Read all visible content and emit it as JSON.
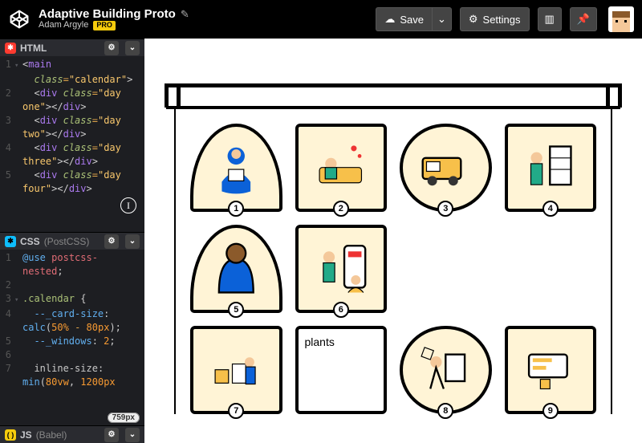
{
  "header": {
    "title": "Adaptive Building Proto",
    "author": "Adam Argyle",
    "author_badge": "PRO",
    "pencil_glyph": "✎",
    "buttons": {
      "save": "Save",
      "save_caret": "⌄",
      "settings": "Settings",
      "cloud_glyph": "☁",
      "gear_glyph": "⚙",
      "layout_glyph": "▥",
      "pin_glyph": "📌"
    }
  },
  "editors": {
    "html": {
      "label": "HTML",
      "gear_glyph": "⚙",
      "caret_glyph": "⌄",
      "cursor_badge": "759px",
      "lines": [
        {
          "n": "1",
          "fold": "▾",
          "html": "<span class='t-punc'>&lt;</span><span class='t-tag'>main</span>"
        },
        {
          "n": "",
          "fold": "",
          "html": "  <span class='t-attr'>class</span><span class='t-op'>=</span><span class='t-str'>\"calendar\"</span><span class='t-punc'>&gt;</span>"
        },
        {
          "n": "2",
          "fold": "",
          "html": "  <span class='t-punc'>&lt;</span><span class='t-tag'>div</span> <span class='t-attr'>class</span><span class='t-op'>=</span><span class='t-str'>\"day</span>"
        },
        {
          "n": "",
          "fold": "",
          "html": "<span class='t-str'>one\"</span><span class='t-punc'>&gt;&lt;/</span><span class='t-tag'>div</span><span class='t-punc'>&gt;</span>"
        },
        {
          "n": "3",
          "fold": "",
          "html": "  <span class='t-punc'>&lt;</span><span class='t-tag'>div</span> <span class='t-attr'>class</span><span class='t-op'>=</span><span class='t-str'>\"day</span>"
        },
        {
          "n": "",
          "fold": "",
          "html": "<span class='t-str'>two\"</span><span class='t-punc'>&gt;&lt;/</span><span class='t-tag'>div</span><span class='t-punc'>&gt;</span>"
        },
        {
          "n": "4",
          "fold": "",
          "html": "  <span class='t-punc'>&lt;</span><span class='t-tag'>div</span> <span class='t-attr'>class</span><span class='t-op'>=</span><span class='t-str'>\"day</span>"
        },
        {
          "n": "",
          "fold": "",
          "html": "<span class='t-str'>three\"</span><span class='t-punc'>&gt;&lt;/</span><span class='t-tag'>div</span><span class='t-punc'>&gt;</span>"
        },
        {
          "n": "5",
          "fold": "",
          "html": "  <span class='t-punc'>&lt;</span><span class='t-tag'>div</span> <span class='t-attr'>class</span><span class='t-op'>=</span><span class='t-str'>\"day</span>"
        },
        {
          "n": "",
          "fold": "",
          "html": "<span class='t-str'>four\"</span><span class='t-punc'>&gt;&lt;/</span><span class='t-tag'>div</span><span class='t-punc'>&gt;</span>"
        }
      ]
    },
    "css": {
      "label": "CSS",
      "variant": "(PostCSS)",
      "lines": [
        {
          "n": "1",
          "fold": "",
          "html": "<span class='t-blue'>@use</span> <span class='t-id'>postcss-</span>"
        },
        {
          "n": "",
          "fold": "",
          "html": "<span class='t-id'>nested</span><span class='t-punc'>;</span>"
        },
        {
          "n": "2",
          "fold": "",
          "html": ""
        },
        {
          "n": "3",
          "fold": "▾",
          "html": "<span class='t-sel'>.calendar</span> <span class='t-punc'>{</span>"
        },
        {
          "n": "4",
          "fold": "",
          "html": "  <span class='t-blue'>--_card-size</span><span class='t-punc'>:</span>"
        },
        {
          "n": "",
          "fold": "",
          "html": "<span class='t-blue'>calc</span><span class='t-punc'>(</span><span class='t-num'>50%</span> <span class='t-op'>-</span> <span class='t-num'>80px</span><span class='t-punc'>);</span>"
        },
        {
          "n": "5",
          "fold": "",
          "html": "  <span class='t-blue'>--_windows</span><span class='t-punc'>:</span> <span class='t-num'>2</span><span class='t-punc'>;</span>"
        },
        {
          "n": "6",
          "fold": "",
          "html": ""
        },
        {
          "n": "7",
          "fold": "",
          "html": "  <span class='t-prop'>inline-size</span><span class='t-punc'>:</span>"
        },
        {
          "n": "",
          "fold": "",
          "html": "<span class='t-blue'>min</span><span class='t-punc'>(</span><span class='t-num'>80vw</span><span class='t-punc'>,</span> <span class='t-num'>1200px</span>"
        }
      ]
    },
    "js": {
      "label": "JS",
      "variant": "(Babel)"
    }
  },
  "preview": {
    "windows": [
      {
        "num": "1",
        "shape": "arch",
        "col": "1",
        "row": "1"
      },
      {
        "num": "2",
        "shape": "rect",
        "col": "2",
        "row": "1"
      },
      {
        "num": "3",
        "shape": "circle",
        "col": "3",
        "row": "1"
      },
      {
        "num": "4",
        "shape": "tall",
        "col": "4",
        "row": "1"
      },
      {
        "num": "5",
        "shape": "arch",
        "col": "1",
        "row": "2"
      },
      {
        "num": "6",
        "shape": "wide",
        "col": "2",
        "row": "2"
      },
      {
        "num": "7",
        "shape": "rect",
        "col": "1",
        "row": "3"
      },
      {
        "num": "8",
        "shape": "circle",
        "col": "3",
        "row": "3"
      },
      {
        "num": "9",
        "shape": "rect",
        "col": "4",
        "row": "3"
      }
    ],
    "plant_label": "plants"
  }
}
